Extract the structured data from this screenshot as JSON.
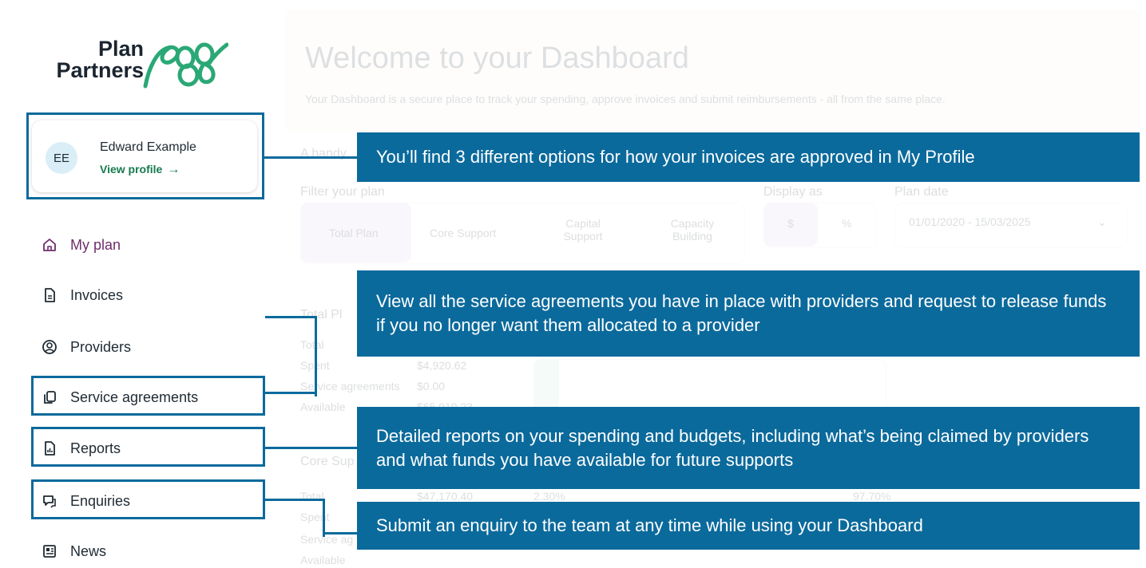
{
  "brand": {
    "line1": "Plan",
    "line2": "Partners",
    "logo_color": "#2aa876"
  },
  "profile": {
    "initials": "EE",
    "name": "Edward Example",
    "link_label": "View profile",
    "link_arrow": "→"
  },
  "nav": [
    {
      "label": "My plan",
      "icon": "home-icon",
      "active": true
    },
    {
      "label": "Invoices",
      "icon": "document-icon",
      "active": false
    },
    {
      "label": "Providers",
      "icon": "user-circle-icon",
      "active": false
    },
    {
      "label": "Service agreements",
      "icon": "copy-icon",
      "active": false
    },
    {
      "label": "Reports",
      "icon": "report-icon",
      "active": false
    },
    {
      "label": "Enquiries",
      "icon": "chat-icon",
      "active": false
    },
    {
      "label": "News",
      "icon": "newspaper-icon",
      "active": false
    }
  ],
  "main": {
    "title": "Welcome to your Dashboard",
    "subtitle": "Your Dashboard is a secure place to track your spending, approve invoices and submit reimbursements - all from the same place.",
    "handy": "A handy",
    "filter_label": "Filter your plan",
    "display_label": "Display as",
    "date_label": "Plan date",
    "tabs": [
      "Total Plan",
      "Core Support",
      "Capital Support",
      "Capacity Building"
    ],
    "display_options": [
      "$",
      "%"
    ],
    "date_range": "01/01/2020 - 15/03/2025",
    "section1": {
      "heading": "Total Pl",
      "rows": [
        "Total",
        "Spent",
        "Service agreements",
        "Available"
      ],
      "values": [
        "",
        "$4,920.62",
        "$0.00",
        "$65,919.23"
      ]
    },
    "section2": {
      "heading": "Core Sup",
      "rows": [
        "Total",
        "Spent",
        "Service ag",
        "Available"
      ],
      "values": [
        "$47,170.40",
        "",
        "",
        ""
      ],
      "pct_left": "2.30%",
      "pct_right": "97.70%"
    }
  },
  "callouts": {
    "profile": "You’ll find 3 different options for how your invoices are approved in My Profile",
    "service": "View all the service agreements you have in place with providers and request to release funds if you no longer want them allocated to a provider",
    "reports": "Detailed reports on your spending and budgets, including what’s being claimed by providers and what funds you have available for future supports",
    "enquiries": "Submit an enquiry to the team at any time while using your Dashboard"
  },
  "colors": {
    "callout": "#0b6a9c",
    "active_nav": "#6e2e6b",
    "link": "#167a4e"
  }
}
